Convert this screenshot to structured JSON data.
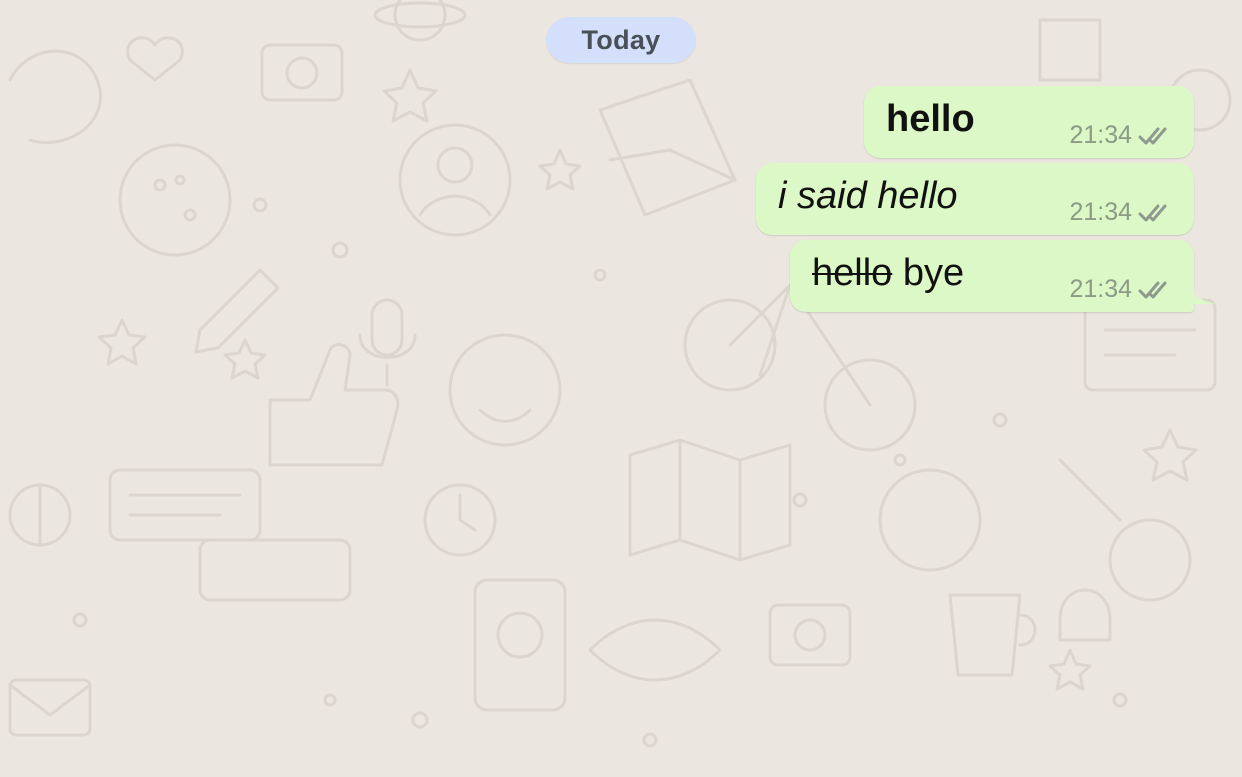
{
  "chat": {
    "date_label": "Today",
    "messages": [
      {
        "text": "hello",
        "style": "bold",
        "time": "21:34",
        "status": "read"
      },
      {
        "text": "i said hello",
        "style": "italic",
        "time": "21:34",
        "status": "read"
      },
      {
        "struck_text": "hello",
        "text": "bye",
        "style": "strikethrough",
        "time": "21:34",
        "status": "read"
      }
    ]
  },
  "colors": {
    "background": "#ebe6df",
    "outgoing_bubble": "#dbf8c6",
    "date_pill": "#d3dffb",
    "timestamp": "#8c9a86"
  },
  "icons": {
    "read_receipt": "double-check-icon"
  }
}
